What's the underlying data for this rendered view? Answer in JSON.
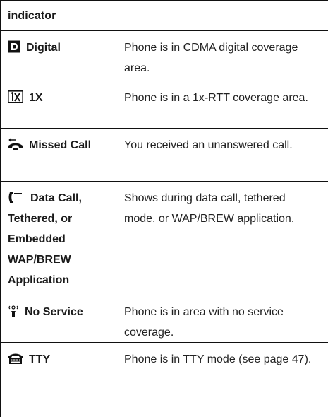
{
  "table": {
    "header": "indicator",
    "rows": [
      {
        "icon": "digital-d-icon",
        "label": "Digital",
        "description": "Phone is in CDMA digital coverage area."
      },
      {
        "icon": "1x-icon",
        "label": "1X",
        "description": "Phone is in a 1x-RTT coverage area."
      },
      {
        "icon": "missed-call-icon",
        "label": "Missed Call",
        "description": "You received an unanswered call."
      },
      {
        "icon": "data-call-icon",
        "label": "Data Call, Tethered, or Embedded WAP/BREW Application",
        "description": "Shows during data call, tethered mode, or WAP/BREW application."
      },
      {
        "icon": "no-service-icon",
        "label": "No Service",
        "description": "Phone is in area with no service coverage."
      },
      {
        "icon": "tty-icon",
        "label": "TTY",
        "description": "Phone is in TTY mode (see page 47)."
      }
    ]
  }
}
